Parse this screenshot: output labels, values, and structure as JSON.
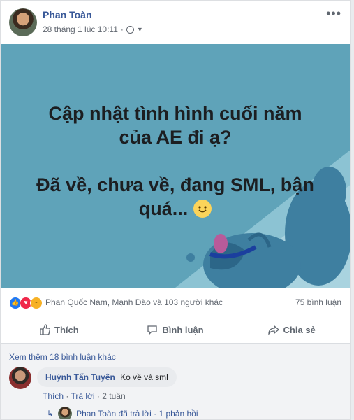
{
  "post": {
    "author": "Phan Toàn",
    "timestamp": "28 tháng 1 lúc 10:11",
    "privacy_icon": "globe-icon",
    "menu_icon": "more-options-icon",
    "more_label": "•••"
  },
  "banner": {
    "background_color": "#5fa3b9",
    "line1": "Cập nhật tình hình cuối năm",
    "line2": "của AE đi ạ?",
    "line3": "Đã về, chưa về, đang SML, bận",
    "line4": "quá...",
    "emoji_icon": "smiley-icon"
  },
  "reactions": {
    "icons": [
      "like-icon",
      "love-icon",
      "haha-icon"
    ],
    "names": "Phan Quốc Nam, Mạnh Đào và 103 người khác",
    "comment_count": "75 bình luận"
  },
  "actions": {
    "like_label": "Thích",
    "comment_label": "Bình luận",
    "share_label": "Chia sẻ"
  },
  "comments": {
    "view_more": "Xem thêm 18 bình luận khác",
    "items": [
      {
        "author": "Huỳnh Tấn Tuyên",
        "text": "Ko về và sml",
        "like_link": "Thích",
        "reply_link": "Trả lời",
        "time": "2 tuần",
        "reply_summary": "Phan Toàn đã trả lời · 1 phản hồi"
      }
    ]
  },
  "colors": {
    "link_blue": "#385898",
    "accent_blue": "#2078f4",
    "banner_teal": "#5fa3b9"
  }
}
